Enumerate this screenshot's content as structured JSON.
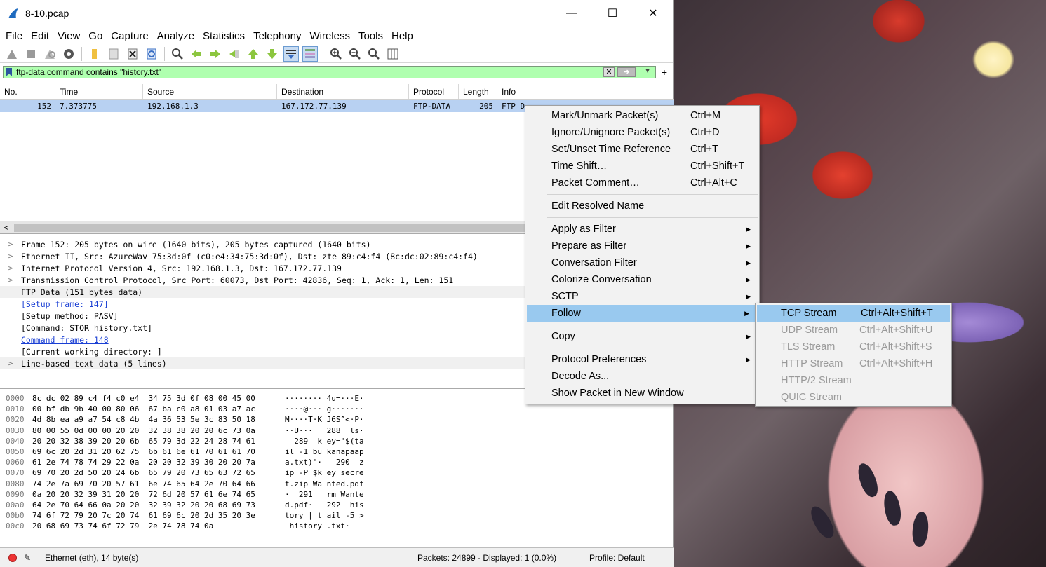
{
  "window": {
    "title": "8-10.pcap",
    "minimize": "—",
    "maximize": "☐",
    "close": "✕"
  },
  "menubar": [
    "File",
    "Edit",
    "View",
    "Go",
    "Capture",
    "Analyze",
    "Statistics",
    "Telephony",
    "Wireless",
    "Tools",
    "Help"
  ],
  "filter": {
    "value": "ftp-data.command contains \"history.txt\""
  },
  "packet_list": {
    "columns": [
      "No.",
      "Time",
      "Source",
      "Destination",
      "Protocol",
      "Length",
      "Info"
    ],
    "rows": [
      {
        "no": "152",
        "time": "7.373775",
        "source": "192.168.1.3",
        "destination": "167.172.77.139",
        "protocol": "FTP-DATA",
        "length": "205",
        "info": "FTP D"
      }
    ]
  },
  "details": [
    {
      "text": "Frame 152: 205 bytes on wire (1640 bits), 205 bytes captured (1640 bits)",
      "expandable": true
    },
    {
      "text": "Ethernet II, Src: AzureWav_75:3d:0f (c0:e4:34:75:3d:0f), Dst: zte_89:c4:f4 (8c:dc:02:89:c4:f4)",
      "expandable": true
    },
    {
      "text": "Internet Protocol Version 4, Src: 192.168.1.3, Dst: 167.172.77.139",
      "expandable": true
    },
    {
      "text": "Transmission Control Protocol, Src Port: 60073, Dst Port: 42836, Seq: 1, Ack: 1, Len: 151",
      "expandable": true
    },
    {
      "text": "FTP Data (151 bytes data)",
      "expandable": false
    },
    {
      "text": "[Setup frame: 147]",
      "expandable": false,
      "link": true
    },
    {
      "text": "[Setup method: PASV]",
      "expandable": false
    },
    {
      "text": "[Command: STOR history.txt]",
      "expandable": false
    },
    {
      "text": "Command frame: 148",
      "expandable": false,
      "link": true
    },
    {
      "text": "[Current working directory: ]",
      "expandable": false
    },
    {
      "text": "Line-based text data (5 lines)",
      "expandable": true
    }
  ],
  "bytes": [
    {
      "off": "0000",
      "hex": "8c dc 02 89 c4 f4 c0 e4  34 75 3d 0f 08 00 45 00",
      "asc": "········ 4u=···E·"
    },
    {
      "off": "0010",
      "hex": "00 bf db 9b 40 00 80 06  67 ba c0 a8 01 03 a7 ac",
      "asc": "····@··· g·······"
    },
    {
      "off": "0020",
      "hex": "4d 8b ea a9 a7 54 c8 4b  4a 36 53 5e 3c 83 50 18",
      "asc": "M····T·K J6S^<·P·"
    },
    {
      "off": "0030",
      "hex": "80 00 55 0d 00 00 20 20  32 38 38 20 20 6c 73 0a",
      "asc": "··U···   288  ls·"
    },
    {
      "off": "0040",
      "hex": "20 20 32 38 39 20 20 6b  65 79 3d 22 24 28 74 61",
      "asc": "  289  k ey=\"$(ta"
    },
    {
      "off": "0050",
      "hex": "69 6c 20 2d 31 20 62 75  6b 61 6e 61 70 61 61 70",
      "asc": "il -1 bu kanapaap"
    },
    {
      "off": "0060",
      "hex": "61 2e 74 78 74 29 22 0a  20 20 32 39 30 20 20 7a",
      "asc": "a.txt)\"·   290  z"
    },
    {
      "off": "0070",
      "hex": "69 70 20 2d 50 20 24 6b  65 79 20 73 65 63 72 65",
      "asc": "ip -P $k ey secre"
    },
    {
      "off": "0080",
      "hex": "74 2e 7a 69 70 20 57 61  6e 74 65 64 2e 70 64 66",
      "asc": "t.zip Wa nted.pdf"
    },
    {
      "off": "0090",
      "hex": "0a 20 20 32 39 31 20 20  72 6d 20 57 61 6e 74 65",
      "asc": "·  291   rm Wante"
    },
    {
      "off": "00a0",
      "hex": "64 2e 70 64 66 0a 20 20  32 39 32 20 20 68 69 73",
      "asc": "d.pdf·   292  his"
    },
    {
      "off": "00b0",
      "hex": "74 6f 72 79 20 7c 20 74  61 69 6c 20 2d 35 20 3e",
      "asc": "tory | t ail -5 >"
    },
    {
      "off": "00c0",
      "hex": "20 68 69 73 74 6f 72 79  2e 74 78 74 0a",
      "asc": " history .txt·"
    }
  ],
  "status": {
    "left": "Ethernet (eth), 14 byte(s)",
    "packets": "Packets: 24899 · Displayed: 1 (0.0%)",
    "profile": "Profile: Default"
  },
  "context_menu": {
    "items": [
      {
        "label": "Mark/Unmark Packet(s)",
        "shortcut": "Ctrl+M"
      },
      {
        "label": "Ignore/Unignore Packet(s)",
        "shortcut": "Ctrl+D"
      },
      {
        "label": "Set/Unset Time Reference",
        "shortcut": "Ctrl+T"
      },
      {
        "label": "Time Shift…",
        "shortcut": "Ctrl+Shift+T"
      },
      {
        "label": "Packet Comment…",
        "shortcut": "Ctrl+Alt+C"
      },
      {
        "label": "Edit Resolved Name",
        "shortcut": ""
      },
      {
        "label": "Apply as Filter",
        "shortcut": ""
      },
      {
        "label": "Prepare as Filter",
        "shortcut": ""
      },
      {
        "label": "Conversation Filter",
        "shortcut": ""
      },
      {
        "label": "Colorize Conversation",
        "shortcut": ""
      },
      {
        "label": "SCTP",
        "shortcut": ""
      },
      {
        "label": "Follow",
        "shortcut": ""
      },
      {
        "label": "Copy",
        "shortcut": ""
      },
      {
        "label": "Protocol Preferences",
        "shortcut": ""
      },
      {
        "label": "Decode As...",
        "shortcut": ""
      },
      {
        "label": "Show Packet in New Window",
        "shortcut": ""
      }
    ]
  },
  "follow_submenu": {
    "items": [
      {
        "label": "TCP Stream",
        "shortcut": "Ctrl+Alt+Shift+T",
        "enabled": true
      },
      {
        "label": "UDP Stream",
        "shortcut": "Ctrl+Alt+Shift+U",
        "enabled": false
      },
      {
        "label": "TLS Stream",
        "shortcut": "Ctrl+Alt+Shift+S",
        "enabled": false
      },
      {
        "label": "HTTP Stream",
        "shortcut": "Ctrl+Alt+Shift+H",
        "enabled": false
      },
      {
        "label": "HTTP/2 Stream",
        "shortcut": "",
        "enabled": false
      },
      {
        "label": "QUIC Stream",
        "shortcut": "",
        "enabled": false
      }
    ]
  },
  "colors": {
    "filter_ok": "#afffaf",
    "selected_row": "#b8d1f2",
    "menu_highlight": "#99c9ef"
  }
}
